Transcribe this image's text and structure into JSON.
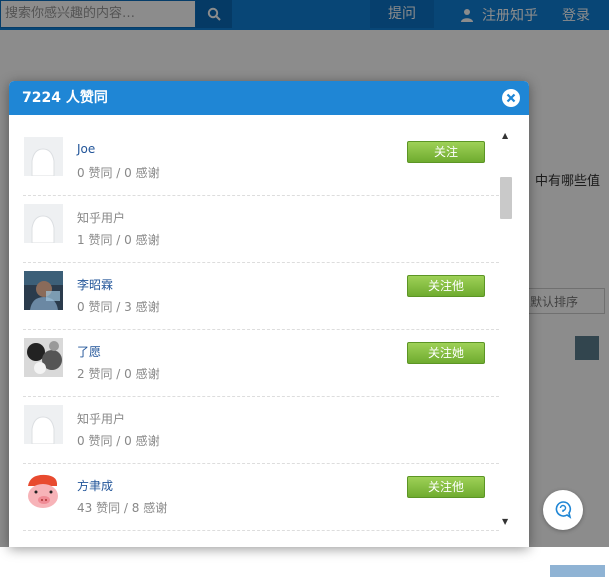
{
  "header": {
    "search_placeholder": "搜索你感兴趣的内容…",
    "ask_label": "提问",
    "signup_label": "注册知乎",
    "login_label": "登录"
  },
  "background": {
    "text_question": "中有哪些值",
    "sort_label": "默认排序"
  },
  "modal": {
    "title": "7224 人赞同",
    "users": [
      {
        "name": "Joe",
        "stats": "0 赞同 / 0 感谢",
        "follow_label": "关注",
        "avatar": "default"
      },
      {
        "name": "知乎用户",
        "stats": "1 赞同 / 0 感谢",
        "follow_label": "",
        "avatar": "default"
      },
      {
        "name": "李昭霖",
        "stats": "0 赞同 / 3 感谢",
        "follow_label": "关注他",
        "avatar": "photo-dark"
      },
      {
        "name": "了愿",
        "stats": "2 赞同 / 0 感谢",
        "follow_label": "关注她",
        "avatar": "photo-bw"
      },
      {
        "name": "知乎用户",
        "stats": "0 赞同 / 0 感谢",
        "follow_label": "",
        "avatar": "default"
      },
      {
        "name": "方聿成",
        "stats": "43 赞同 / 8 感谢",
        "follow_label": "关注他",
        "avatar": "pig-cartoon"
      }
    ]
  },
  "colors": {
    "brand_blue": "#1f86d5",
    "follow_green": "#7cb93b",
    "link_blue": "#225599"
  }
}
